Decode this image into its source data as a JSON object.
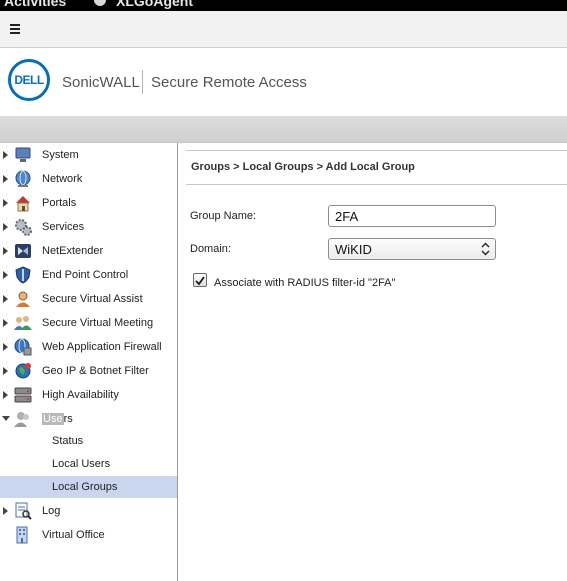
{
  "top_bar": {
    "activities": "Activities",
    "app_name": "XLGoAgent"
  },
  "header": {
    "logo_text": "DELL",
    "brand": "SonicWALL",
    "product": "Secure Remote Access"
  },
  "sidebar": {
    "items": [
      {
        "label": "System",
        "icon": "system-monitor-icon"
      },
      {
        "label": "Network",
        "icon": "network-globe-icon"
      },
      {
        "label": "Portals",
        "icon": "portals-house-icon"
      },
      {
        "label": "Services",
        "icon": "services-gears-icon"
      },
      {
        "label": "NetExtender",
        "icon": "netextender-icon"
      },
      {
        "label": "End Point Control",
        "icon": "shield-icon"
      },
      {
        "label": "Secure Virtual Assist",
        "icon": "assist-person-icon"
      },
      {
        "label": "Secure Virtual Meeting",
        "icon": "meeting-people-icon"
      },
      {
        "label": "Web Application Firewall",
        "icon": "firewall-globe-icon"
      },
      {
        "label": "Geo IP & Botnet Filter",
        "icon": "geo-ip-icon"
      },
      {
        "label": "High Availability",
        "icon": "server-icon"
      }
    ],
    "users": {
      "label": "Users",
      "label_highlighted": "Use",
      "label_rest": "rs",
      "icon": "users-icon",
      "children": [
        {
          "label": "Status"
        },
        {
          "label": "Local Users"
        },
        {
          "label": "Local Groups",
          "selected": true
        }
      ]
    },
    "log": {
      "label": "Log",
      "icon": "log-magnifier-icon"
    },
    "virtual_office": {
      "label": "Virtual Office",
      "icon": "virtual-office-icon"
    }
  },
  "main": {
    "breadcrumb": "Groups > Local Groups > Add Local Group",
    "group_name_label": "Group Name:",
    "group_name_value": "2FA",
    "domain_label": "Domain:",
    "domain_value": "WiKID",
    "associate_checked": true,
    "associate_label": "Associate with RADIUS filter-id \"2FA\""
  }
}
